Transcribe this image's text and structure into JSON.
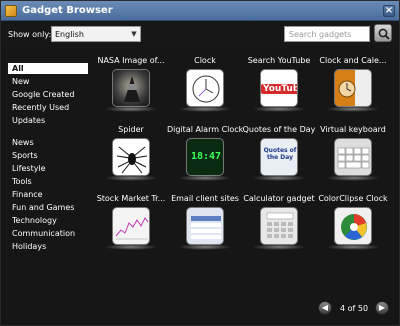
{
  "window": {
    "title": "Gadget Browser"
  },
  "toolbar": {
    "show_only_label": "Show only:",
    "language": "English",
    "search_placeholder": "Search gadgets"
  },
  "sidebar": {
    "items": [
      "All",
      "New",
      "Google Created",
      "Recently Used",
      "Updates"
    ],
    "categories": [
      "News",
      "Sports",
      "Lifestyle",
      "Tools",
      "Finance",
      "Fun and Games",
      "Technology",
      "Communication",
      "Holidays"
    ],
    "selected": "All"
  },
  "gadgets": [
    {
      "label": "NASA Image of..."
    },
    {
      "label": "Clock"
    },
    {
      "label": "Search YouTube",
      "thumb_text": "YouTube"
    },
    {
      "label": "Clock and Cale..."
    },
    {
      "label": "Spider"
    },
    {
      "label": "Digital Alarm Clock",
      "thumb_text": "18:47"
    },
    {
      "label": "Quotes of the Day",
      "thumb_text": "Quotes of the Day"
    },
    {
      "label": "Virtual keyboard"
    },
    {
      "label": "Stock Market Tr..."
    },
    {
      "label": "Email client sites"
    },
    {
      "label": "Calculator gadget"
    },
    {
      "label": "ColorClipse Clock"
    }
  ],
  "pagination": {
    "text": "4 of 50"
  },
  "colors": {
    "background": "#161616",
    "titlebar": "#5a7cab",
    "selected_bg": "#ffffff"
  }
}
